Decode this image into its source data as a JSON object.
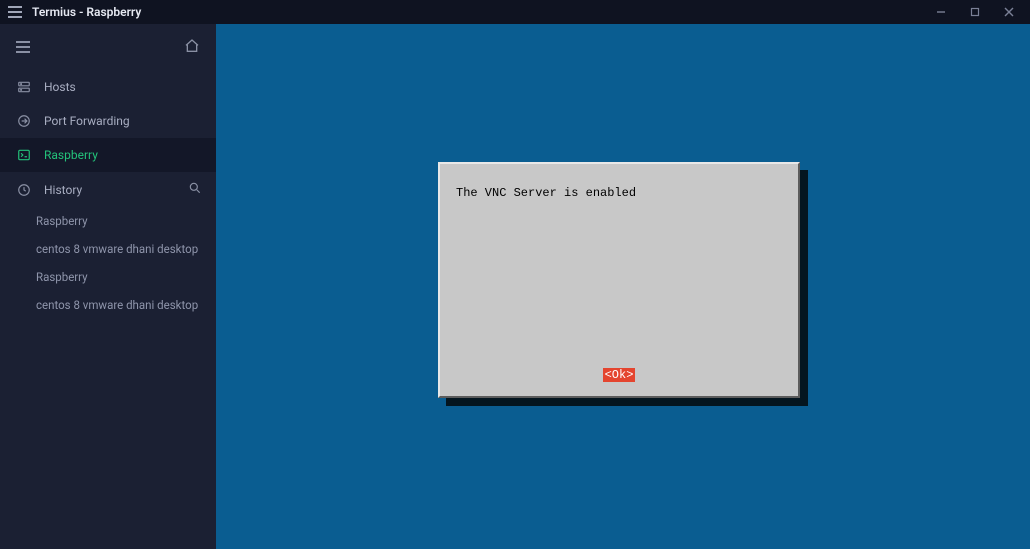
{
  "window": {
    "title": "Termius - Raspberry"
  },
  "sidebar": {
    "nav": [
      {
        "id": "hosts",
        "label": "Hosts",
        "icon": "server"
      },
      {
        "id": "portfwd",
        "label": "Port Forwarding",
        "icon": "forward"
      },
      {
        "id": "raspberry",
        "label": "Raspberry",
        "icon": "terminal",
        "active": true
      }
    ],
    "history_label": "History",
    "history_items": [
      "Raspberry",
      "centos 8 vmware dhani desktop",
      "Raspberry",
      "centos 8 vmware dhani desktop"
    ]
  },
  "terminal": {
    "dialog_message": "The VNC Server is enabled",
    "ok_label": "<Ok>"
  },
  "colors": {
    "accent": "#23c27a",
    "terminal_bg": "#0a5d91",
    "dialog_bg": "#c8c8c8",
    "ok_bg": "#e4452f"
  }
}
